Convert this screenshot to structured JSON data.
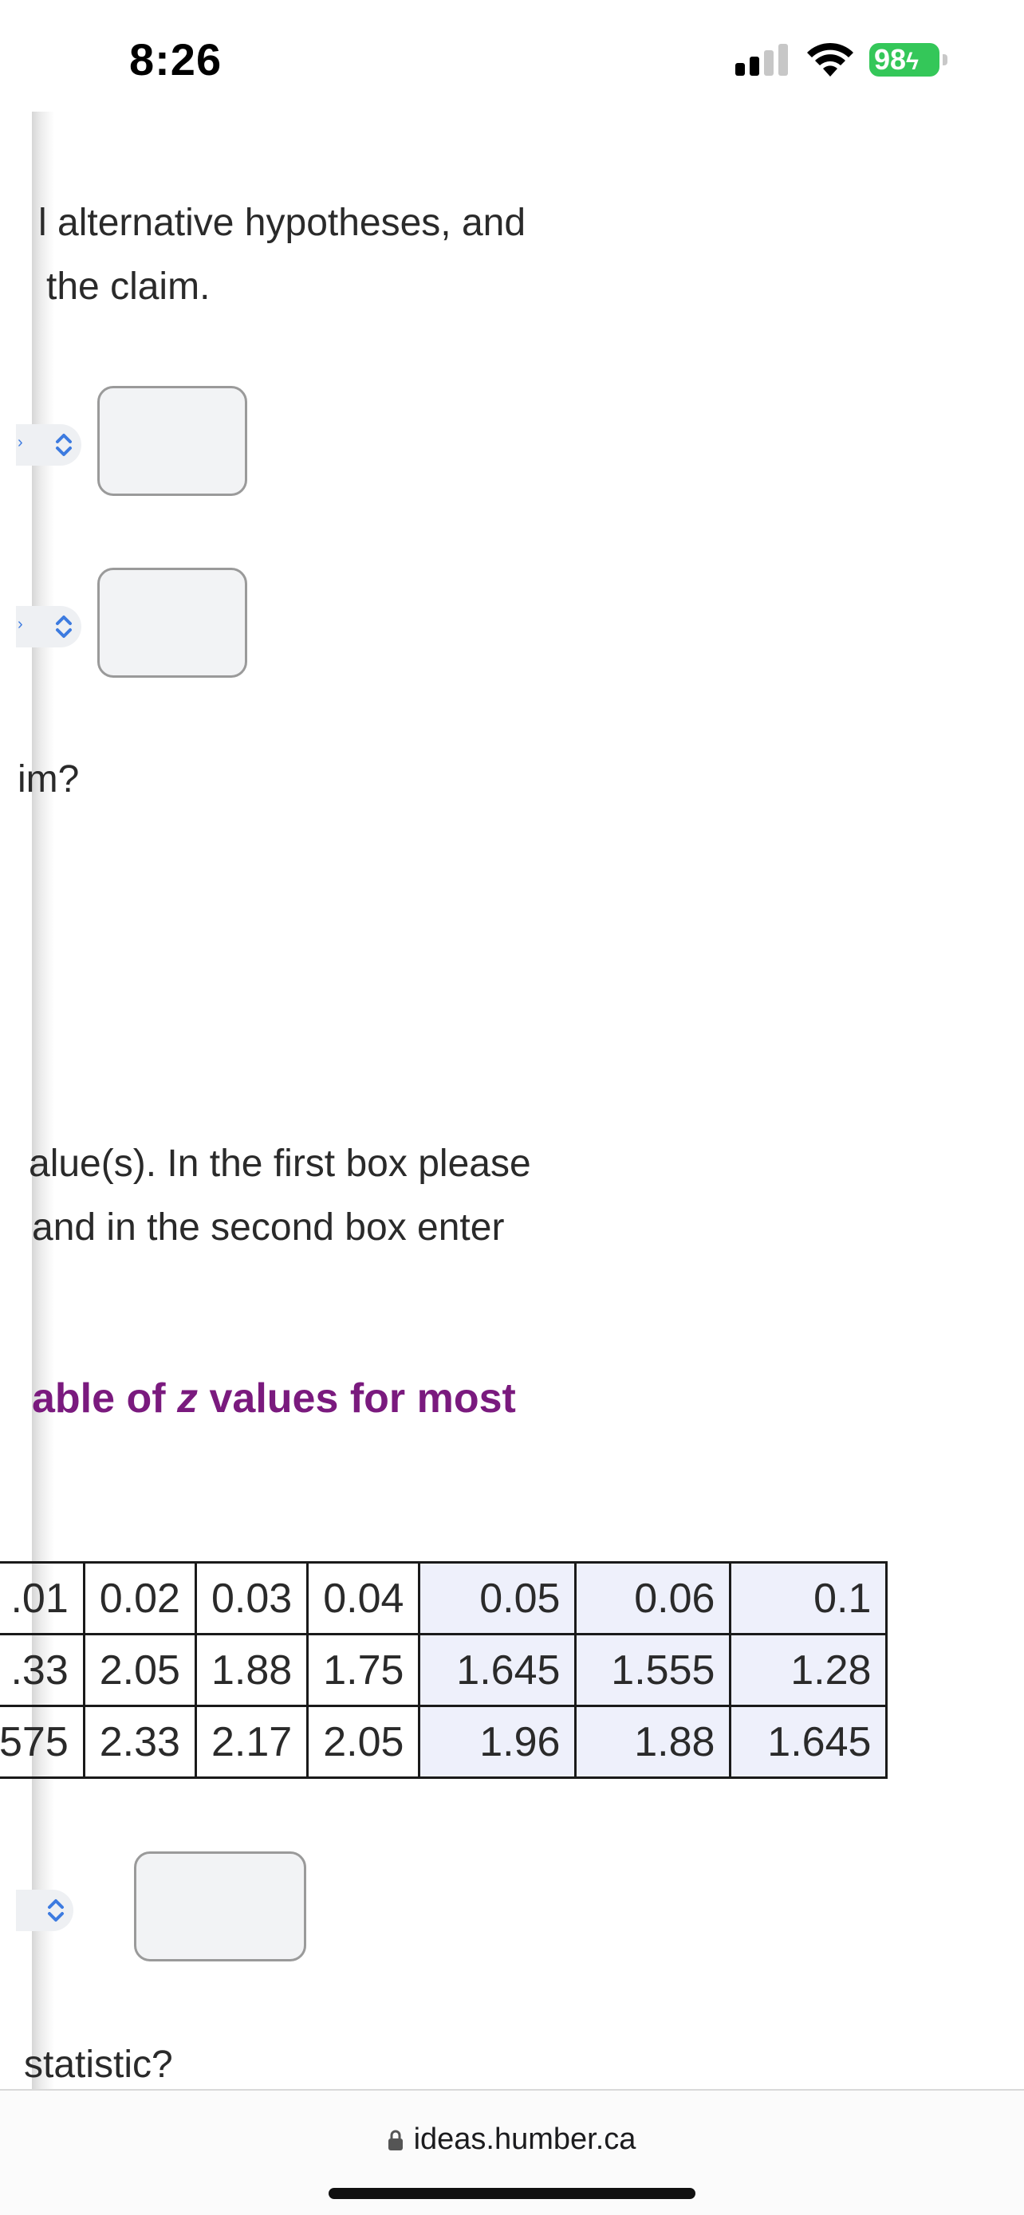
{
  "status_bar": {
    "time": "8:26",
    "battery": "98"
  },
  "paragraphs": {
    "p1_line1": "l alternative hypotheses, and",
    "p1_line2": "the claim.",
    "p2": "im?",
    "p3_line1": "alue(s). In the first box please",
    "p3_line2": "and in the second box enter",
    "last": "statistic?"
  },
  "heading": {
    "part1": "able  of ",
    "z": "z",
    "part2": " values  for most"
  },
  "selects": [
    {
      "icon": "chevron-up-down-icon"
    },
    {
      "icon": "chevron-up-down-icon"
    },
    {
      "icon": "chevron-up-down-icon"
    }
  ],
  "z_table": {
    "rows": [
      [
        ".01",
        "0.02",
        "0.03",
        "0.04",
        "0.05",
        "0.06",
        "0.1"
      ],
      [
        ".33",
        "2.05",
        "1.88",
        "1.75",
        "1.645",
        "1.555",
        "1.28"
      ],
      [
        "575",
        "2.33",
        "2.17",
        "2.05",
        "1.96",
        "1.88",
        "1.645"
      ]
    ]
  },
  "url_bar": {
    "domain": "ideas.humber.ca"
  },
  "colors": {
    "heading": "#7a1a7e",
    "battery": "#34c759",
    "chevron": "#3d7be0"
  }
}
